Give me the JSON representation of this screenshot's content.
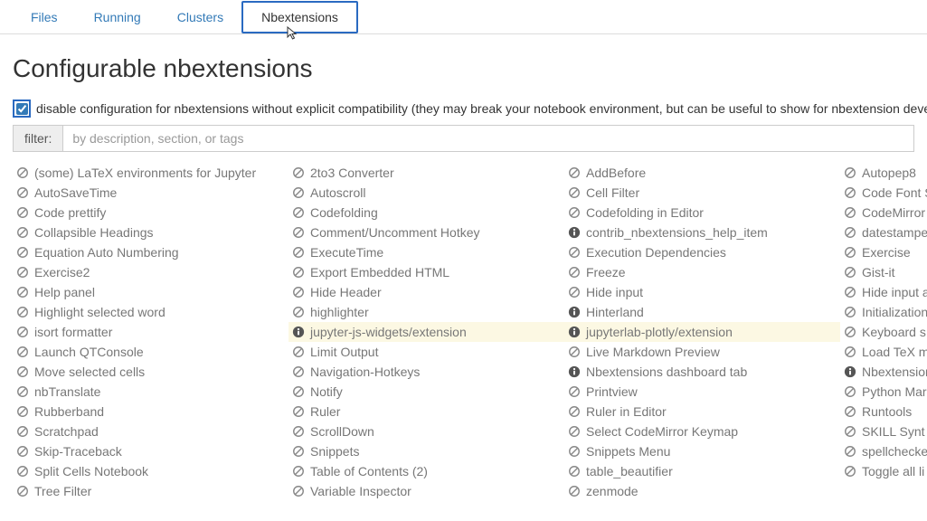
{
  "tabs": {
    "files": "Files",
    "running": "Running",
    "clusters": "Clusters",
    "nbextensions": "Nbextensions"
  },
  "page_title": "Configurable nbextensions",
  "disable_checkbox_label": "disable configuration for nbextensions without explicit compatibility (they may break your notebook environment, but can be useful to show for nbextension develo",
  "filter": {
    "label": "filter:",
    "placeholder": "by description, section, or tags"
  },
  "extensions": [
    {
      "name": "(some) LaTeX environments for Jupyter",
      "icon": "disabled"
    },
    {
      "name": "2to3 Converter",
      "icon": "disabled"
    },
    {
      "name": "AddBefore",
      "icon": "disabled"
    },
    {
      "name": "Autopep8",
      "icon": "disabled"
    },
    {
      "name": "AutoSaveTime",
      "icon": "disabled"
    },
    {
      "name": "Autoscroll",
      "icon": "disabled"
    },
    {
      "name": "Cell Filter",
      "icon": "disabled"
    },
    {
      "name": "Code Font S",
      "icon": "disabled"
    },
    {
      "name": "Code prettify",
      "icon": "disabled"
    },
    {
      "name": "Codefolding",
      "icon": "disabled"
    },
    {
      "name": "Codefolding in Editor",
      "icon": "disabled"
    },
    {
      "name": "CodeMirror",
      "icon": "disabled"
    },
    {
      "name": "Collapsible Headings",
      "icon": "disabled"
    },
    {
      "name": "Comment/Uncomment Hotkey",
      "icon": "disabled"
    },
    {
      "name": "contrib_nbextensions_help_item",
      "icon": "info"
    },
    {
      "name": "datestampe",
      "icon": "disabled"
    },
    {
      "name": "Equation Auto Numbering",
      "icon": "disabled"
    },
    {
      "name": "ExecuteTime",
      "icon": "disabled"
    },
    {
      "name": "Execution Dependencies",
      "icon": "disabled"
    },
    {
      "name": "Exercise",
      "icon": "disabled"
    },
    {
      "name": "Exercise2",
      "icon": "disabled"
    },
    {
      "name": "Export Embedded HTML",
      "icon": "disabled"
    },
    {
      "name": "Freeze",
      "icon": "disabled"
    },
    {
      "name": "Gist-it",
      "icon": "disabled"
    },
    {
      "name": "Help panel",
      "icon": "disabled"
    },
    {
      "name": "Hide Header",
      "icon": "disabled"
    },
    {
      "name": "Hide input",
      "icon": "disabled"
    },
    {
      "name": "Hide input a",
      "icon": "disabled"
    },
    {
      "name": "Highlight selected word",
      "icon": "disabled"
    },
    {
      "name": "highlighter",
      "icon": "disabled"
    },
    {
      "name": "Hinterland",
      "icon": "info"
    },
    {
      "name": "Initialization",
      "icon": "disabled"
    },
    {
      "name": "isort formatter",
      "icon": "disabled"
    },
    {
      "name": "jupyter-js-widgets/extension",
      "icon": "info",
      "hl": true
    },
    {
      "name": "jupyterlab-plotly/extension",
      "icon": "info",
      "hl": true
    },
    {
      "name": "Keyboard s",
      "icon": "disabled"
    },
    {
      "name": "Launch QTConsole",
      "icon": "disabled"
    },
    {
      "name": "Limit Output",
      "icon": "disabled"
    },
    {
      "name": "Live Markdown Preview",
      "icon": "disabled"
    },
    {
      "name": "Load TeX m",
      "icon": "disabled"
    },
    {
      "name": "Move selected cells",
      "icon": "disabled"
    },
    {
      "name": "Navigation-Hotkeys",
      "icon": "disabled"
    },
    {
      "name": "Nbextensions dashboard tab",
      "icon": "info"
    },
    {
      "name": "Nbextension",
      "icon": "info"
    },
    {
      "name": "nbTranslate",
      "icon": "disabled"
    },
    {
      "name": "Notify",
      "icon": "disabled"
    },
    {
      "name": "Printview",
      "icon": "disabled"
    },
    {
      "name": "Python Mar",
      "icon": "disabled"
    },
    {
      "name": "Rubberband",
      "icon": "disabled"
    },
    {
      "name": "Ruler",
      "icon": "disabled"
    },
    {
      "name": "Ruler in Editor",
      "icon": "disabled"
    },
    {
      "name": "Runtools",
      "icon": "disabled"
    },
    {
      "name": "Scratchpad",
      "icon": "disabled"
    },
    {
      "name": "ScrollDown",
      "icon": "disabled"
    },
    {
      "name": "Select CodeMirror Keymap",
      "icon": "disabled"
    },
    {
      "name": "SKILL Synt",
      "icon": "disabled"
    },
    {
      "name": "Skip-Traceback",
      "icon": "disabled"
    },
    {
      "name": "Snippets",
      "icon": "disabled"
    },
    {
      "name": "Snippets Menu",
      "icon": "disabled"
    },
    {
      "name": "spellchecke",
      "icon": "disabled"
    },
    {
      "name": "Split Cells Notebook",
      "icon": "disabled"
    },
    {
      "name": "Table of Contents (2)",
      "icon": "disabled"
    },
    {
      "name": "table_beautifier",
      "icon": "disabled"
    },
    {
      "name": "Toggle all li",
      "icon": "disabled"
    },
    {
      "name": "Tree Filter",
      "icon": "disabled"
    },
    {
      "name": "Variable Inspector",
      "icon": "disabled"
    },
    {
      "name": "zenmode",
      "icon": "disabled"
    }
  ]
}
